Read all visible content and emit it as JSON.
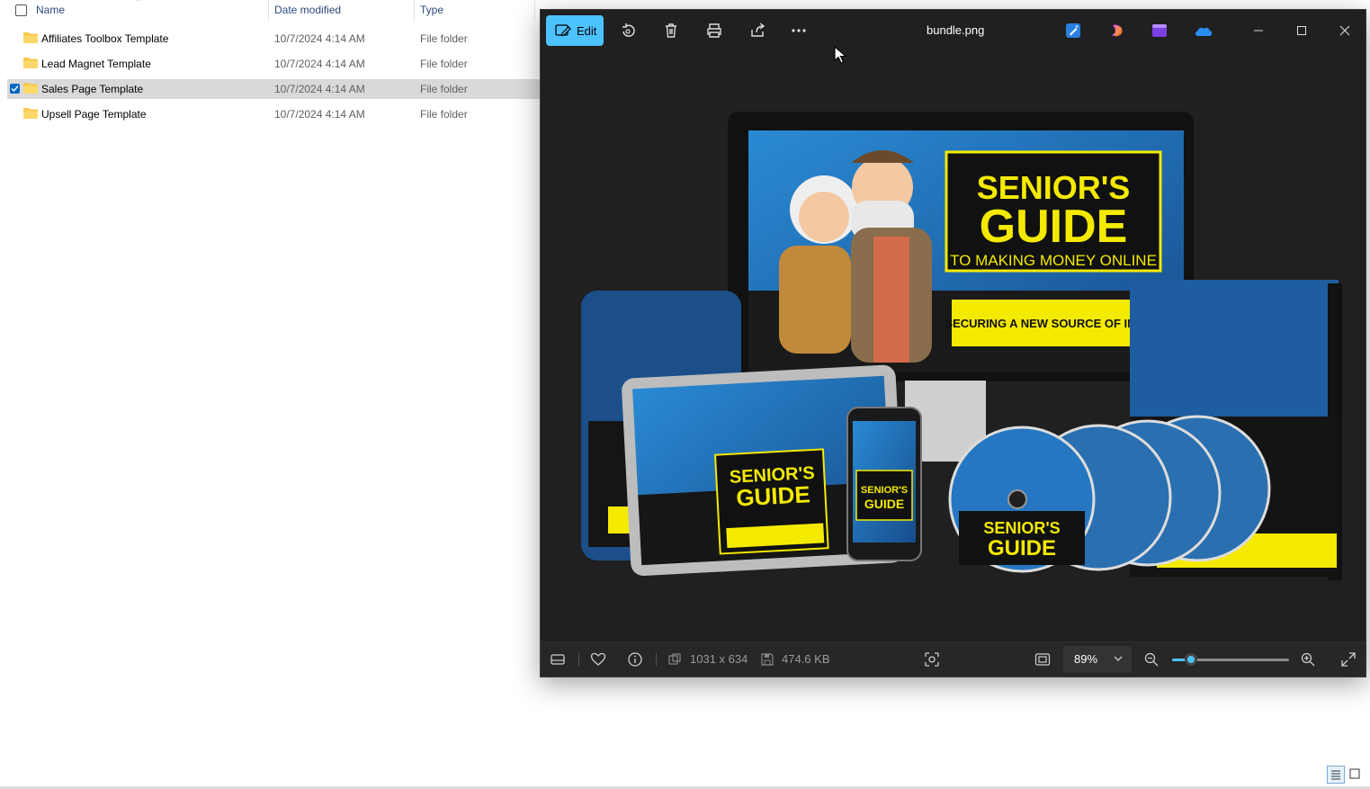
{
  "explorer": {
    "columns": {
      "name": "Name",
      "date_modified": "Date modified",
      "type": "Type"
    },
    "rows": [
      {
        "name": "Affiliates Toolbox Template",
        "date": "10/7/2024 4:14 AM",
        "type": "File folder"
      },
      {
        "name": "Lead Magnet Template",
        "date": "10/7/2024 4:14 AM",
        "type": "File folder"
      },
      {
        "name": "Sales Page Template",
        "date": "10/7/2024 4:14 AM",
        "type": "File folder"
      },
      {
        "name": "Upsell Page Template",
        "date": "10/7/2024 4:14 AM",
        "type": "File folder"
      }
    ]
  },
  "photos": {
    "edit_label": "Edit",
    "file_name": "bundle.png",
    "image": {
      "title_line1": "SENIOR'S",
      "title_line2": "GUIDE",
      "subtitle": "TO MAKING MONEY ONLINE",
      "tagline": "SECURING A NEW SOURCE OF INCOME"
    },
    "dimensions": "1031 x 634",
    "file_size": "474.6 KB",
    "zoom": "89%",
    "zoom_level_fraction": 0.16
  },
  "colors": {
    "accent": "#4cc2ff",
    "photos_bg": "#202020",
    "selection": "#d9d9d9",
    "folder": "#f8c84a",
    "cover_yellow": "#f4ea00",
    "cover_blue": "#1f6fb5"
  }
}
